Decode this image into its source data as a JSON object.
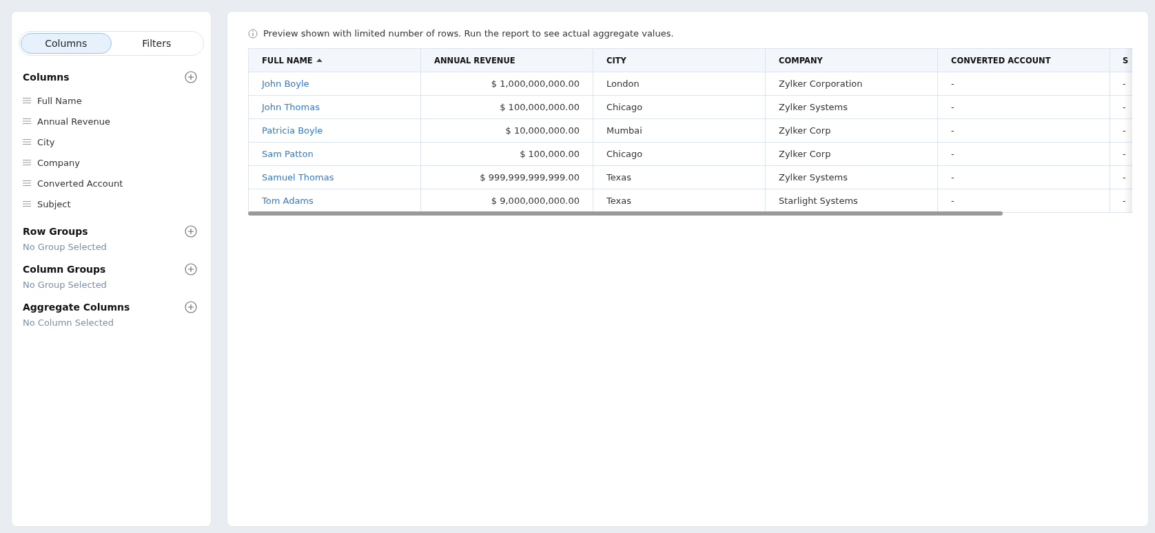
{
  "sidebar": {
    "tabs": [
      {
        "label": "Columns",
        "selected": true
      },
      {
        "label": "Filters",
        "selected": false
      }
    ],
    "sections": [
      {
        "title": "Columns",
        "items": [
          "Full Name",
          "Annual Revenue",
          "City",
          "Company",
          "Converted Account",
          "Subject"
        ]
      },
      {
        "title": "Row Groups",
        "empty_text": "No Group Selected"
      },
      {
        "title": "Column Groups",
        "empty_text": "No Group Selected"
      },
      {
        "title": "Aggregate Columns",
        "empty_text": "No Column Selected"
      }
    ]
  },
  "notice": "Preview shown with limited number of rows. Run the report to see actual aggregate values.",
  "table": {
    "columns": [
      {
        "label": "FULL NAME",
        "sorted": true
      },
      {
        "label": "ANNUAL REVENUE",
        "sorted": false
      },
      {
        "label": "CITY",
        "sorted": false
      },
      {
        "label": "COMPANY",
        "sorted": false
      },
      {
        "label": "CONVERTED ACCOUNT",
        "sorted": false
      },
      {
        "label": "S",
        "sorted": false
      }
    ],
    "rows": [
      [
        "John Boyle",
        "$ 1,000,000,000.00",
        "London",
        "Zylker Corporation",
        "-",
        "-"
      ],
      [
        "John Thomas",
        "$ 100,000,000.00",
        "Chicago",
        "Zylker Systems",
        "-",
        "-"
      ],
      [
        "Patricia Boyle",
        "$ 10,000,000.00",
        "Mumbai",
        "Zylker Corp",
        "-",
        "-"
      ],
      [
        "Sam Patton",
        "$ 100,000.00",
        "Chicago",
        "Zylker Corp",
        "-",
        "-"
      ],
      [
        "Samuel Thomas",
        "$ 999,999,999,999.00",
        "Texas",
        "Zylker Systems",
        "-",
        "-"
      ],
      [
        "Tom Adams",
        "$ 9,000,000,000.00",
        "Texas",
        "Starlight Systems",
        "-",
        "-"
      ]
    ]
  }
}
